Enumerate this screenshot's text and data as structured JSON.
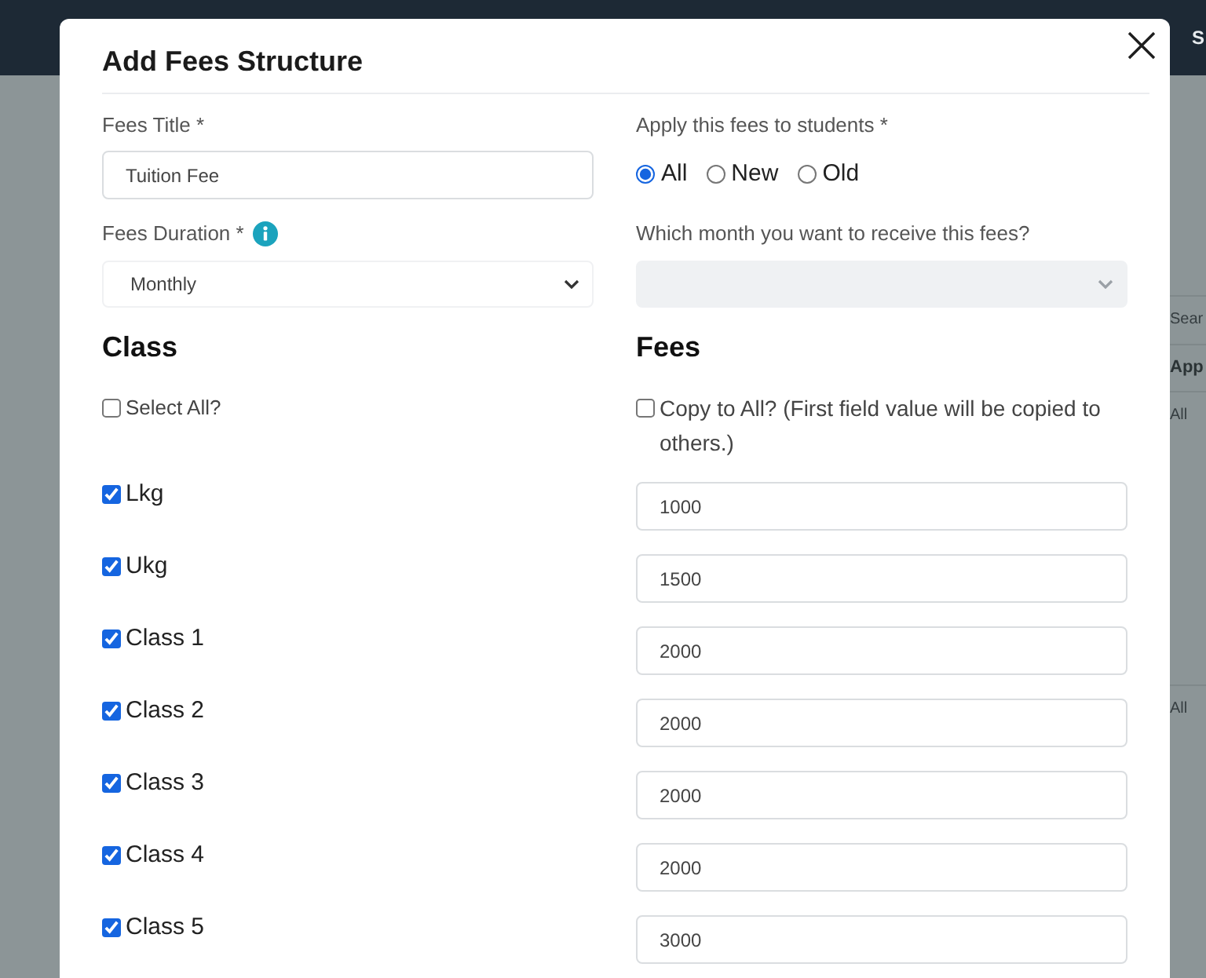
{
  "page": {
    "top_bar": {
      "text": "S"
    },
    "side_texts": [
      {
        "kind": "search",
        "text": "Sear"
      },
      {
        "kind": "header",
        "text": "App"
      },
      {
        "kind": "cell",
        "text": "All"
      },
      {
        "kind": "cell",
        "text": "All"
      }
    ]
  },
  "modal": {
    "title": "Add Fees Structure",
    "fees_title": {
      "label": "Fees Title *",
      "value": "Tuition Fee"
    },
    "apply_to": {
      "label": "Apply this fees to students *",
      "options": [
        {
          "label": "All",
          "selected": true
        },
        {
          "label": "New",
          "selected": false
        },
        {
          "label": "Old",
          "selected": false
        }
      ]
    },
    "fees_duration": {
      "label": "Fees Duration *",
      "value": "Monthly"
    },
    "receive_month": {
      "label": "Which month you want to receive this fees?",
      "disabled": true
    },
    "class_section": {
      "heading": "Class",
      "select_all": {
        "label": "Select All?",
        "checked": false
      }
    },
    "fees_section": {
      "heading": "Fees",
      "copy_all": {
        "label": "Copy to All? (First field value will be copied to others.)",
        "checked": false
      }
    },
    "rows": [
      {
        "class": "Lkg",
        "checked": true,
        "fee": "1000"
      },
      {
        "class": "Ukg",
        "checked": true,
        "fee": "1500"
      },
      {
        "class": "Class 1",
        "checked": true,
        "fee": "2000"
      },
      {
        "class": "Class 2",
        "checked": true,
        "fee": "2000"
      },
      {
        "class": "Class 3",
        "checked": true,
        "fee": "2000"
      },
      {
        "class": "Class 4",
        "checked": true,
        "fee": "2000"
      },
      {
        "class": "Class 5",
        "checked": true,
        "fee": "3000"
      }
    ]
  }
}
